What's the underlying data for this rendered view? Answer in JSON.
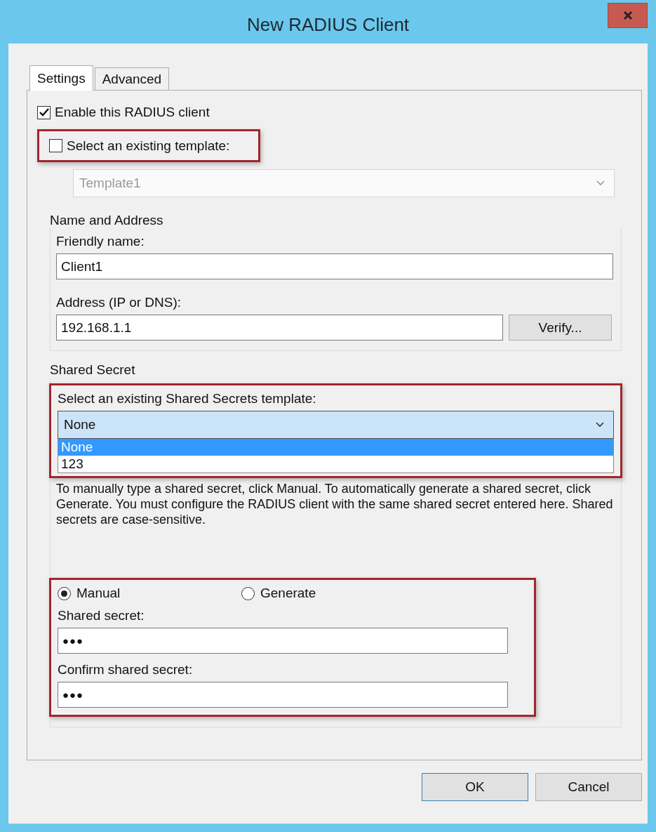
{
  "window": {
    "title": "New RADIUS Client"
  },
  "tabs": [
    {
      "label": "Settings",
      "selected": true
    },
    {
      "label": "Advanced",
      "selected": false
    }
  ],
  "enable_client": {
    "label": "Enable this RADIUS client",
    "checked": true
  },
  "use_template": {
    "label": "Select an existing template:",
    "checked": false,
    "highlighted": true
  },
  "template_select": {
    "value": "Template1",
    "disabled": true
  },
  "name_and_address": {
    "title": "Name and Address",
    "friendly_name": {
      "label": "Friendly name:",
      "value": "Client1"
    },
    "address": {
      "label": "Address (IP or DNS):",
      "value": "192.168.1.1"
    },
    "verify_button": "Verify..."
  },
  "shared_secret": {
    "title": "Shared Secret",
    "highlighted": true,
    "template_label": "Select an existing Shared Secrets template:",
    "template_value": "None",
    "options": [
      {
        "label": "None",
        "selected": true
      },
      {
        "label": "123",
        "selected": false
      }
    ],
    "help": "To manually type a shared secret, click Manual. To automatically generate a shared secret, click Generate. You must configure the RADIUS client with the same shared secret entered here. Shared secrets are case-sensitive.",
    "mode_highlighted": true,
    "modes": [
      {
        "label": "Manual",
        "selected": true
      },
      {
        "label": "Generate",
        "selected": false
      }
    ],
    "secret": {
      "label": "Shared secret:",
      "value": "●●●"
    },
    "confirm": {
      "label": "Confirm shared secret:",
      "value": "●●●"
    }
  },
  "buttons": [
    {
      "label": "OK",
      "default": true
    },
    {
      "label": "Cancel",
      "default": false
    }
  ]
}
